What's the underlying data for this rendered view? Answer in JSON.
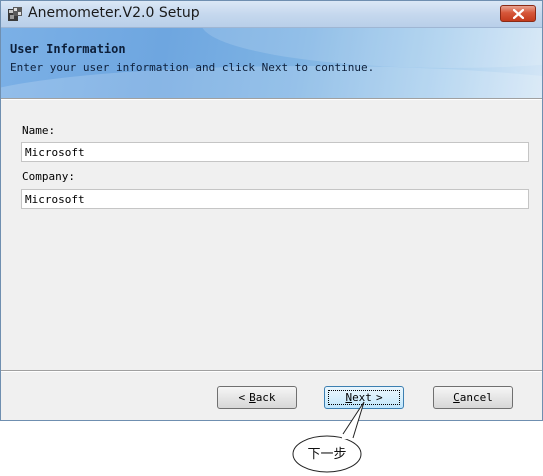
{
  "window": {
    "title": "Anemometer.V2.0 Setup"
  },
  "header": {
    "title": "User Information",
    "subtitle": "Enter your user information and click Next to continue."
  },
  "form": {
    "name_label": "Name:",
    "name_value": "Microsoft",
    "company_label": "Company:",
    "company_value": "Microsoft"
  },
  "buttons": {
    "back_prefix": "<",
    "back_key": "B",
    "back_rest": "ack",
    "next_key": "N",
    "next_rest": "ext",
    "next_suffix": ">",
    "cancel_key": "C",
    "cancel_rest": "ancel"
  },
  "annotation": {
    "text": "下一步"
  },
  "icons": {
    "app": "setup-icon",
    "close": "close-icon"
  },
  "colors": {
    "close_red": "#c33a1c",
    "header_blue": "#7bb0e6",
    "focus_blue": "#3c7fb1"
  }
}
